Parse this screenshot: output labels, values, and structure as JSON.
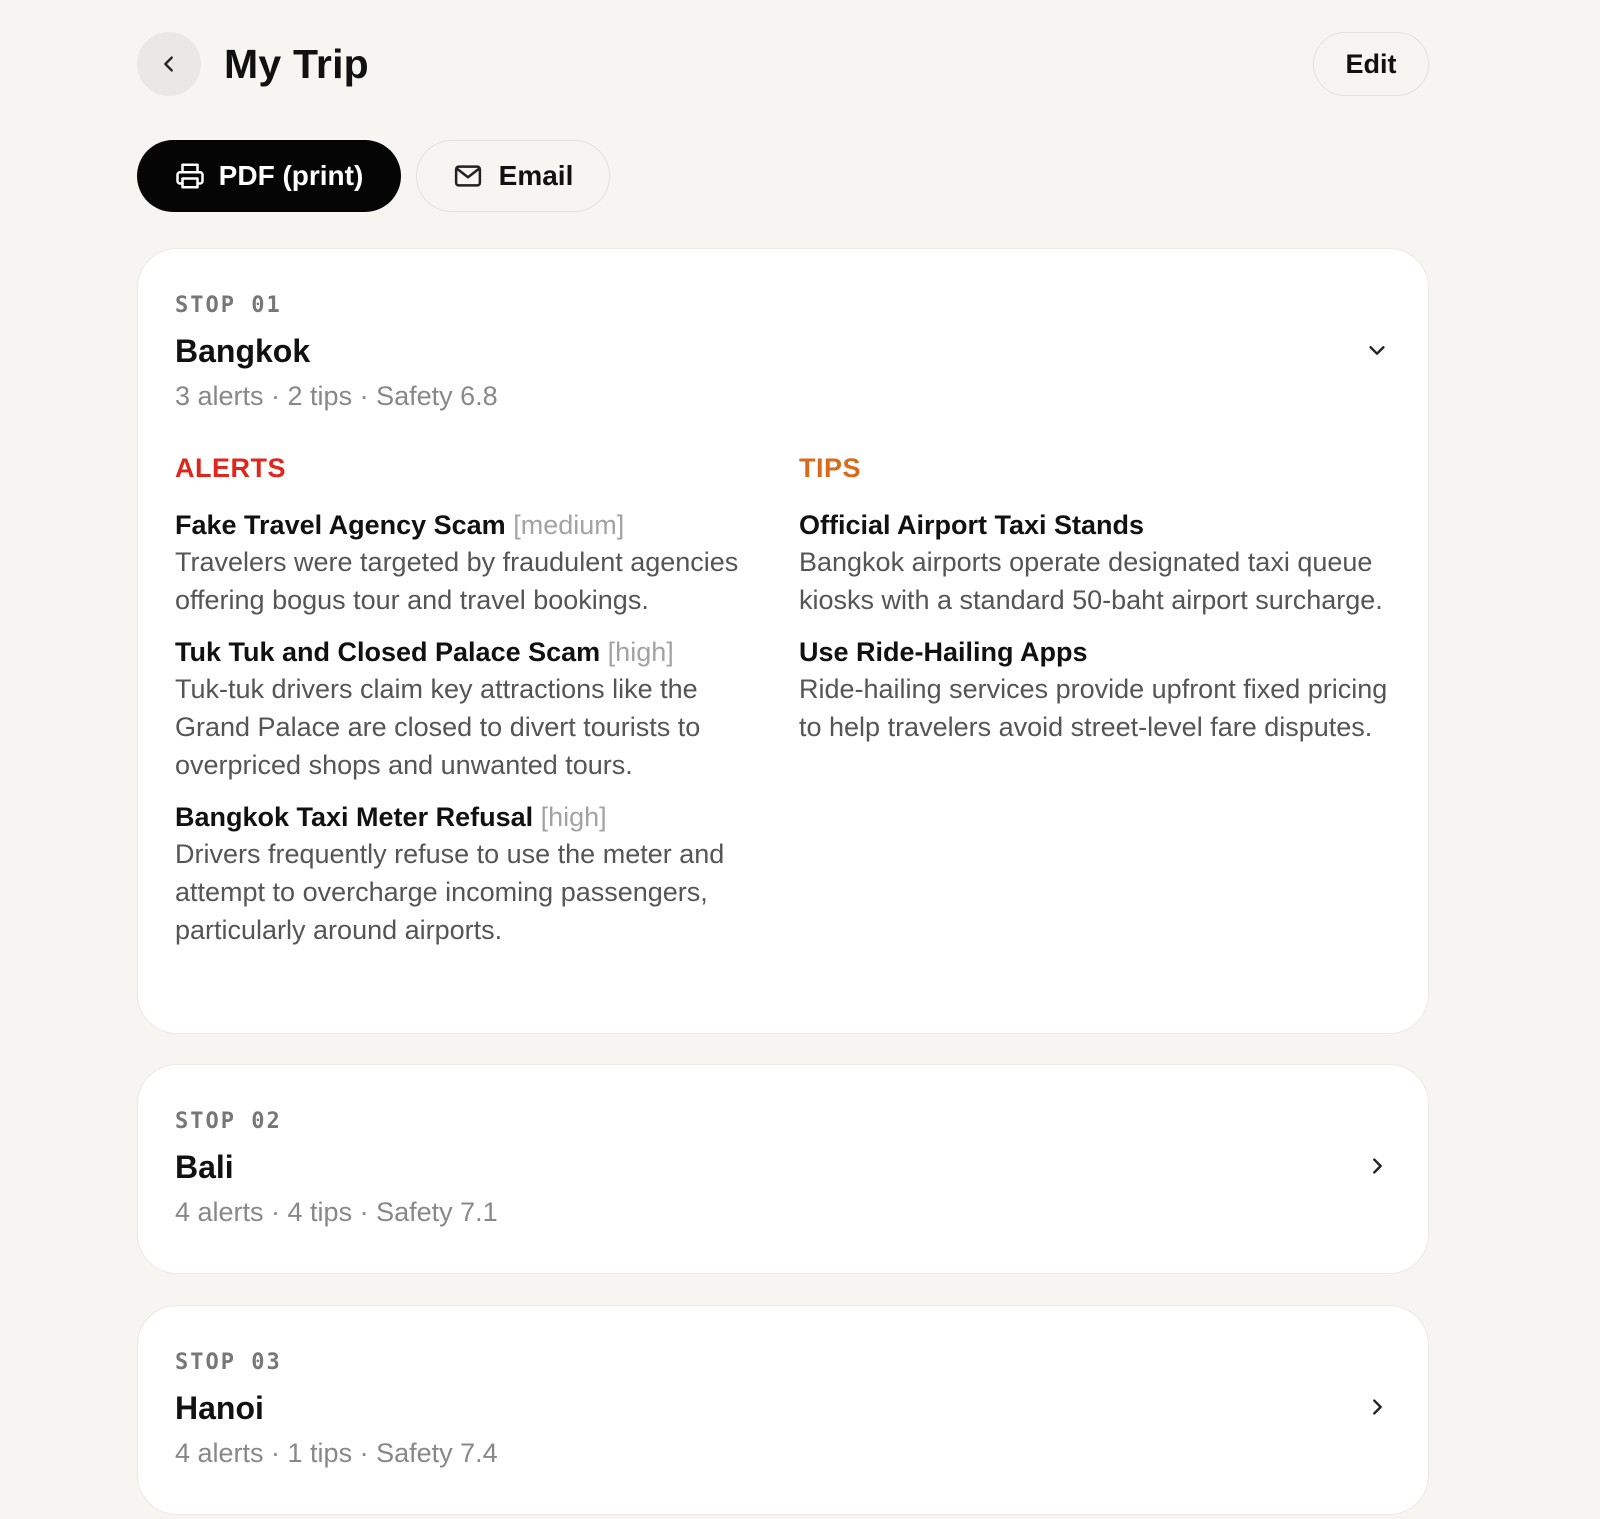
{
  "header": {
    "back_icon": "chevron-left-icon",
    "title": "My Trip",
    "edit_label": "Edit"
  },
  "actions": {
    "pdf_label": "PDF (print)",
    "pdf_icon": "printer-icon",
    "email_label": "Email",
    "email_icon": "mail-icon"
  },
  "stops": [
    {
      "label": "STOP 01",
      "city": "Bangkok",
      "summary": "3 alerts · 2 tips · Safety 6.8",
      "expanded": true,
      "alerts_heading": "ALERTS",
      "tips_heading": "TIPS",
      "alerts": [
        {
          "title": "Fake Travel Agency Scam",
          "severity": "[medium]",
          "description": "Travelers were targeted by fraudulent agencies offering bogus tour and travel bookings."
        },
        {
          "title": "Tuk Tuk and Closed Palace Scam",
          "severity": "[high]",
          "description": "Tuk-tuk drivers claim key attractions like the Grand Palace are closed to divert tourists to overpriced shops and unwanted tours."
        },
        {
          "title": "Bangkok Taxi Meter Refusal",
          "severity": "[high]",
          "description": "Drivers frequently refuse to use the meter and attempt to overcharge incoming passengers, particularly around airports."
        }
      ],
      "tips": [
        {
          "title": "Official Airport Taxi Stands",
          "description": "Bangkok airports operate designated taxi queue kiosks with a standard 50-baht airport surcharge."
        },
        {
          "title": "Use Ride-Hailing Apps",
          "description": "Ride-hailing services provide upfront fixed pricing to help travelers avoid street-level fare disputes."
        }
      ]
    },
    {
      "label": "STOP 02",
      "city": "Bali",
      "summary": "4 alerts · 4 tips · Safety 7.1",
      "expanded": false
    },
    {
      "label": "STOP 03",
      "city": "Hanoi",
      "summary": "4 alerts · 1 tips · Safety 7.4",
      "expanded": false
    }
  ],
  "colors": {
    "background": "#f6f5f2",
    "alerts_heading": "#e0261c",
    "tips_heading": "#d86a1a",
    "primary_button": "#050505"
  }
}
